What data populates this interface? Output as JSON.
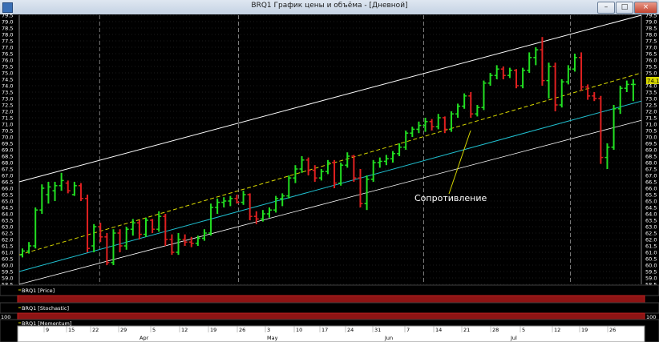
{
  "window": {
    "title": "BRQ1 График цены и объёма - [Дневной]",
    "buttons": {
      "minimize": "–",
      "maximize": "□",
      "close": "×"
    }
  },
  "panes": {
    "price_label": "BRQ1 [Price]",
    "stochastic_label": "BRQ1 [Stochastic]",
    "momentum_label": "BRQ1 [Momentum]",
    "momentum_left": "100",
    "momentum_right": "100"
  },
  "annotation": "Сопротивление",
  "last_price": "74.10",
  "colors": {
    "up": "#22e022",
    "down": "#e02020",
    "channel": "#ffffff",
    "dashed": "#d8d800",
    "teal": "#20c0d0",
    "grid": "#3a3a3a"
  },
  "chart_data": {
    "type": "ohlc",
    "y_ticks": [
      "79.5",
      "79.0",
      "78.5",
      "78.0",
      "77.5",
      "77.0",
      "76.5",
      "76.0",
      "75.5",
      "75.0",
      "74.5",
      "74.0",
      "73.5",
      "73.0",
      "72.5",
      "72.0",
      "71.5",
      "71.0",
      "70.5",
      "70.0",
      "69.5",
      "69.0",
      "68.5",
      "68.0",
      "67.5",
      "67.0",
      "66.5",
      "66.0",
      "65.5",
      "65.0",
      "64.5",
      "64.0",
      "63.5",
      "63.0",
      "62.5",
      "62.0",
      "61.5",
      "61.0",
      "60.5",
      "60.0",
      "59.5",
      "59.0",
      "58.5"
    ],
    "ylim": [
      58.5,
      79.5
    ],
    "x_day_labels": [
      "9",
      "15",
      "22",
      "29",
      "5",
      "12",
      "19",
      "26",
      "3",
      "10",
      "17",
      "24",
      "31",
      "7",
      "14",
      "21",
      "28",
      "5",
      "12",
      "19",
      "26"
    ],
    "x_month_labels": [
      "Apr",
      "May",
      "Jun",
      "Jul"
    ],
    "bars": [
      {
        "o": 60.8,
        "h": 61.3,
        "l": 60.6,
        "c": 61.1
      },
      {
        "o": 61.1,
        "h": 61.8,
        "l": 60.9,
        "c": 61.5
      },
      {
        "o": 61.5,
        "h": 64.5,
        "l": 61.3,
        "c": 64.3
      },
      {
        "o": 64.3,
        "h": 66.3,
        "l": 64.0,
        "c": 66.0
      },
      {
        "o": 65.5,
        "h": 66.5,
        "l": 64.8,
        "c": 66.1
      },
      {
        "o": 65.8,
        "h": 66.5,
        "l": 65.0,
        "c": 66.2
      },
      {
        "o": 66.2,
        "h": 67.2,
        "l": 65.8,
        "c": 66.6
      },
      {
        "o": 66.4,
        "h": 66.6,
        "l": 65.6,
        "c": 65.8
      },
      {
        "o": 65.5,
        "h": 66.5,
        "l": 65.4,
        "c": 66.2
      },
      {
        "o": 66.2,
        "h": 66.4,
        "l": 65.0,
        "c": 65.2
      },
      {
        "o": 65.2,
        "h": 65.5,
        "l": 61.0,
        "c": 61.3
      },
      {
        "o": 61.5,
        "h": 63.2,
        "l": 61.0,
        "c": 63.0
      },
      {
        "o": 63.0,
        "h": 63.3,
        "l": 61.8,
        "c": 62.2
      },
      {
        "o": 62.2,
        "h": 62.5,
        "l": 60.0,
        "c": 60.2
      },
      {
        "o": 60.2,
        "h": 62.8,
        "l": 60.0,
        "c": 62.5
      },
      {
        "o": 62.5,
        "h": 62.8,
        "l": 61.0,
        "c": 61.5
      },
      {
        "o": 61.5,
        "h": 63.0,
        "l": 61.2,
        "c": 62.8
      },
      {
        "o": 62.8,
        "h": 63.6,
        "l": 62.3,
        "c": 63.3
      },
      {
        "o": 63.3,
        "h": 63.5,
        "l": 62.0,
        "c": 62.4
      },
      {
        "o": 62.4,
        "h": 63.7,
        "l": 62.2,
        "c": 63.5
      },
      {
        "o": 63.5,
        "h": 63.6,
        "l": 62.5,
        "c": 62.8
      },
      {
        "o": 62.8,
        "h": 64.2,
        "l": 62.6,
        "c": 63.8
      },
      {
        "o": 63.8,
        "h": 64.0,
        "l": 61.5,
        "c": 62.0
      },
      {
        "o": 62.0,
        "h": 62.4,
        "l": 60.8,
        "c": 61.0
      },
      {
        "o": 61.0,
        "h": 62.5,
        "l": 60.8,
        "c": 62.0
      },
      {
        "o": 62.0,
        "h": 62.4,
        "l": 61.5,
        "c": 61.8
      },
      {
        "o": 61.8,
        "h": 62.2,
        "l": 61.4,
        "c": 61.7
      },
      {
        "o": 61.7,
        "h": 62.3,
        "l": 61.5,
        "c": 62.1
      },
      {
        "o": 62.1,
        "h": 62.8,
        "l": 61.9,
        "c": 62.5
      },
      {
        "o": 62.5,
        "h": 64.8,
        "l": 62.3,
        "c": 64.5
      },
      {
        "o": 64.5,
        "h": 65.2,
        "l": 64.0,
        "c": 64.9
      },
      {
        "o": 64.9,
        "h": 65.3,
        "l": 64.5,
        "c": 65.0
      },
      {
        "o": 65.0,
        "h": 65.4,
        "l": 64.6,
        "c": 65.2
      },
      {
        "o": 65.2,
        "h": 65.5,
        "l": 64.8,
        "c": 64.9
      },
      {
        "o": 64.9,
        "h": 65.8,
        "l": 64.7,
        "c": 65.5
      },
      {
        "o": 65.5,
        "h": 65.6,
        "l": 63.5,
        "c": 63.8
      },
      {
        "o": 63.8,
        "h": 64.2,
        "l": 63.2,
        "c": 63.6
      },
      {
        "o": 63.6,
        "h": 64.3,
        "l": 63.4,
        "c": 64.0
      },
      {
        "o": 64.0,
        "h": 64.5,
        "l": 63.7,
        "c": 64.3
      },
      {
        "o": 64.3,
        "h": 65.4,
        "l": 64.1,
        "c": 65.2
      },
      {
        "o": 65.2,
        "h": 65.6,
        "l": 64.6,
        "c": 65.4
      },
      {
        "o": 65.4,
        "h": 67.0,
        "l": 65.2,
        "c": 66.8
      },
      {
        "o": 66.8,
        "h": 67.8,
        "l": 66.4,
        "c": 67.5
      },
      {
        "o": 67.5,
        "h": 68.5,
        "l": 67.2,
        "c": 68.2
      },
      {
        "o": 68.2,
        "h": 68.4,
        "l": 67.0,
        "c": 67.4
      },
      {
        "o": 67.4,
        "h": 67.8,
        "l": 66.5,
        "c": 66.8
      },
      {
        "o": 66.8,
        "h": 67.5,
        "l": 66.6,
        "c": 67.3
      },
      {
        "o": 67.3,
        "h": 68.2,
        "l": 67.1,
        "c": 68.0
      },
      {
        "o": 68.0,
        "h": 68.2,
        "l": 66.0,
        "c": 66.4
      },
      {
        "o": 66.4,
        "h": 68.0,
        "l": 66.2,
        "c": 67.8
      },
      {
        "o": 67.8,
        "h": 68.8,
        "l": 67.6,
        "c": 68.5
      },
      {
        "o": 68.5,
        "h": 68.6,
        "l": 66.5,
        "c": 66.8
      },
      {
        "o": 66.8,
        "h": 67.5,
        "l": 64.5,
        "c": 64.8
      },
      {
        "o": 64.8,
        "h": 67.0,
        "l": 64.3,
        "c": 66.7
      },
      {
        "o": 66.7,
        "h": 68.2,
        "l": 66.5,
        "c": 68.0
      },
      {
        "o": 68.0,
        "h": 68.4,
        "l": 67.6,
        "c": 68.1
      },
      {
        "o": 68.1,
        "h": 68.6,
        "l": 67.8,
        "c": 68.3
      },
      {
        "o": 68.3,
        "h": 68.9,
        "l": 68.0,
        "c": 68.7
      },
      {
        "o": 68.7,
        "h": 69.5,
        "l": 68.5,
        "c": 69.2
      },
      {
        "o": 69.2,
        "h": 70.5,
        "l": 69.0,
        "c": 70.3
      },
      {
        "o": 70.3,
        "h": 70.8,
        "l": 70.0,
        "c": 70.6
      },
      {
        "o": 70.6,
        "h": 71.2,
        "l": 70.3,
        "c": 70.9
      },
      {
        "o": 70.9,
        "h": 71.5,
        "l": 70.4,
        "c": 71.2
      },
      {
        "o": 71.2,
        "h": 71.4,
        "l": 70.5,
        "c": 70.8
      },
      {
        "o": 70.8,
        "h": 71.8,
        "l": 70.6,
        "c": 71.5
      },
      {
        "o": 71.5,
        "h": 71.6,
        "l": 70.3,
        "c": 70.6
      },
      {
        "o": 70.6,
        "h": 72.0,
        "l": 70.4,
        "c": 71.8
      },
      {
        "o": 71.8,
        "h": 72.6,
        "l": 71.5,
        "c": 72.4
      },
      {
        "o": 72.4,
        "h": 73.4,
        "l": 72.2,
        "c": 73.2
      },
      {
        "o": 73.2,
        "h": 73.5,
        "l": 71.5,
        "c": 71.8
      },
      {
        "o": 71.8,
        "h": 72.5,
        "l": 71.6,
        "c": 72.3
      },
      {
        "o": 72.3,
        "h": 74.4,
        "l": 72.1,
        "c": 74.2
      },
      {
        "o": 74.2,
        "h": 75.0,
        "l": 74.0,
        "c": 74.8
      },
      {
        "o": 74.8,
        "h": 75.6,
        "l": 74.5,
        "c": 75.3
      },
      {
        "o": 75.3,
        "h": 75.5,
        "l": 74.5,
        "c": 74.8
      },
      {
        "o": 74.8,
        "h": 75.4,
        "l": 74.6,
        "c": 75.2
      },
      {
        "o": 75.2,
        "h": 75.3,
        "l": 73.8,
        "c": 74.0
      },
      {
        "o": 74.0,
        "h": 75.4,
        "l": 73.8,
        "c": 75.2
      },
      {
        "o": 75.2,
        "h": 76.6,
        "l": 75.0,
        "c": 76.2
      },
      {
        "o": 76.2,
        "h": 77.0,
        "l": 75.6,
        "c": 76.8
      },
      {
        "o": 76.8,
        "h": 77.8,
        "l": 74.0,
        "c": 74.4
      },
      {
        "o": 74.4,
        "h": 75.8,
        "l": 73.0,
        "c": 75.5
      },
      {
        "o": 75.5,
        "h": 75.8,
        "l": 72.0,
        "c": 72.5
      },
      {
        "o": 72.5,
        "h": 74.5,
        "l": 72.3,
        "c": 74.3
      },
      {
        "o": 74.3,
        "h": 75.6,
        "l": 74.1,
        "c": 75.3
      },
      {
        "o": 75.3,
        "h": 76.5,
        "l": 75.1,
        "c": 76.2
      },
      {
        "o": 76.2,
        "h": 76.6,
        "l": 73.6,
        "c": 73.9
      },
      {
        "o": 73.9,
        "h": 74.1,
        "l": 72.9,
        "c": 73.2
      },
      {
        "o": 73.2,
        "h": 73.5,
        "l": 72.8,
        "c": 73.0
      },
      {
        "o": 73.0,
        "h": 73.2,
        "l": 67.9,
        "c": 68.4
      },
      {
        "o": 68.4,
        "h": 69.5,
        "l": 67.5,
        "c": 69.2
      },
      {
        "o": 69.2,
        "h": 72.5,
        "l": 69.0,
        "c": 72.2
      },
      {
        "o": 72.2,
        "h": 74.0,
        "l": 71.8,
        "c": 73.8
      },
      {
        "o": 73.8,
        "h": 74.4,
        "l": 73.5,
        "c": 74.1
      },
      {
        "o": 74.1,
        "h": 74.5,
        "l": 72.8,
        "c": 74.1
      }
    ]
  }
}
